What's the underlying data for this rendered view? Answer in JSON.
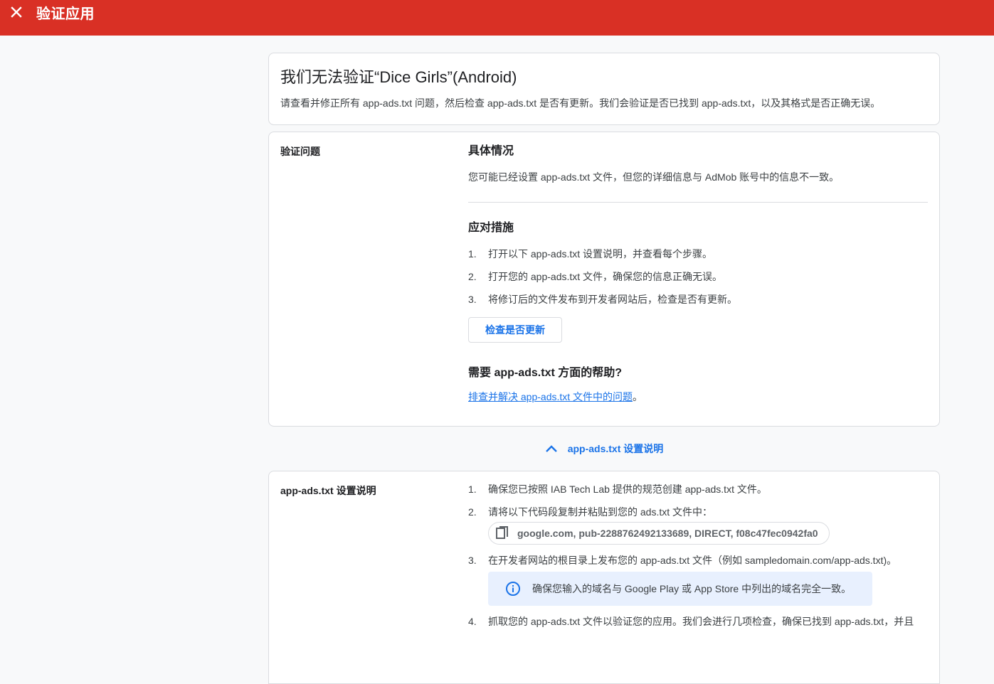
{
  "topbar": {
    "close_icon": "close-icon",
    "title": "验证应用",
    "background": "#d93025"
  },
  "header_card": {
    "headline": "我们无法验证“Dice Girls”(Android)",
    "description": "请查看并修正所有 app-ads.txt 问题，然后检查 app-ads.txt 是否有更新。我们会验证是否已找到 app-ads.txt，以及其格式是否正确无误。"
  },
  "issues_card": {
    "label": "验证问题",
    "details_title": "具体情况",
    "details_text": "您可能已经设置 app-ads.txt 文件，但您的详细信息与 AdMob 账号中的信息不一致。",
    "actions_title": "应对措施",
    "actions": [
      {
        "num": "1.",
        "text": "打开以下 app-ads.txt 设置说明，并查看每个步骤。"
      },
      {
        "num": "2.",
        "text": "打开您的 app-ads.txt 文件，确保您的信息正确无误。"
      },
      {
        "num": "3.",
        "text": "将修订后的文件发布到开发者网站后，检查是否有更新。"
      }
    ],
    "check_button": "检查是否更新",
    "help_title": "需要 app-ads.txt 方面的帮助?",
    "help_link": "排查并解决 app-ads.txt 文件中的问题",
    "help_suffix": "。"
  },
  "toggle": {
    "icon": "chevron-up-icon",
    "label": "app-ads.txt 设置说明"
  },
  "setup_card": {
    "label": "app-ads.txt 设置说明",
    "steps": [
      {
        "num": "1.",
        "text": "确保您已按照 IAB Tech Lab 提供的规范创建 app-ads.txt 文件。"
      },
      {
        "num": "2.",
        "text": "请将以下代码段复制并粘贴到您的 ads.txt 文件中："
      },
      {
        "num": "3.",
        "text": "在开发者网站的根目录上发布您的 app-ads.txt 文件（例如 sampledomain.com/app-ads.txt)。"
      },
      {
        "num": "4.",
        "text": "抓取您的 app-ads.txt 文件以验证您的应用。我们会进行几项检查，确保已找到 app-ads.txt，并且"
      }
    ],
    "code_snippet": "google.com, pub-2288762492133689, DIRECT, f08c47fec0942fa0",
    "copy_icon": "copy-icon",
    "info_icon": "info-icon",
    "info_text": "确保您输入的域名与 Google Play 或 App Store 中列出的域名完全一致。"
  },
  "colors": {
    "accent": "#1a73e8",
    "info_bg": "#e8f0fe",
    "border": "#dadce0"
  }
}
